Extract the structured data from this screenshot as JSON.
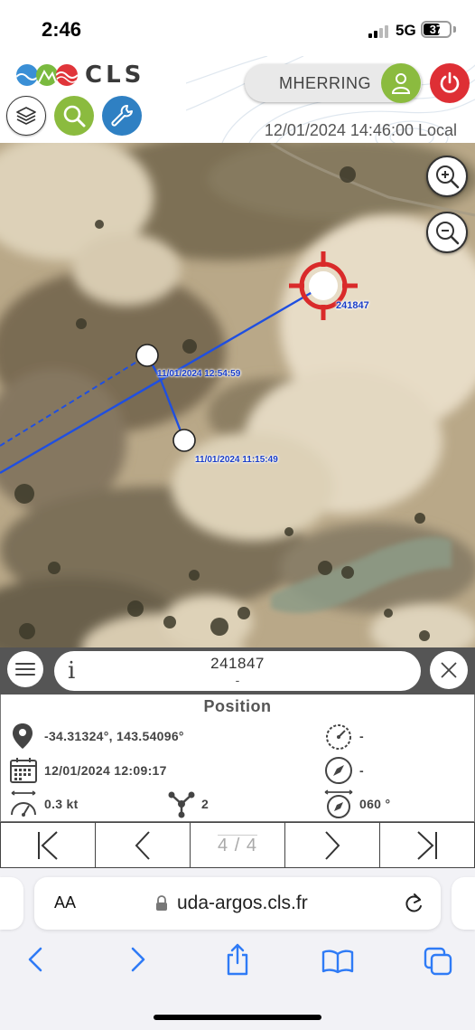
{
  "status_bar": {
    "time": "2:46",
    "network": "5G",
    "battery": "37",
    "battery_level": 0.37
  },
  "app": {
    "logo_text": "CLS",
    "brand_colors": {
      "green": "#8bbb3f",
      "blue": "#2f80c3",
      "red": "#de2f35"
    },
    "user_name": "MHERRING",
    "datetime": "12/01/2024 14:46:00 Local",
    "header_buttons": [
      "layers-icon",
      "search-icon",
      "wrench-icon"
    ]
  },
  "map": {
    "target_label": "241847",
    "waypoints": [
      {
        "label": "11/01/2024 12:54:59"
      },
      {
        "label": "11/01/2024 11:15:49"
      }
    ],
    "track_color": "#1f4fe0",
    "target_color": "#d92a2a",
    "zoom_in_icon": "zoom-in-icon",
    "zoom_out_icon": "zoom-out-icon"
  },
  "panel": {
    "title": "241847",
    "subtitle": "-",
    "info_icon": "i",
    "section_title": "Position",
    "rows": {
      "coordinates": "-34.31324°, 143.54096°",
      "datetime": "12/01/2024 12:09:17",
      "speed": "0.3 kt",
      "satellites": "2",
      "gauge_value": "-",
      "compass_value": "-",
      "heading": "060 °"
    },
    "pager": {
      "count": "4 / 4"
    }
  },
  "browser": {
    "aa_label": "AA",
    "url": "uda-argos.cls.fr"
  }
}
